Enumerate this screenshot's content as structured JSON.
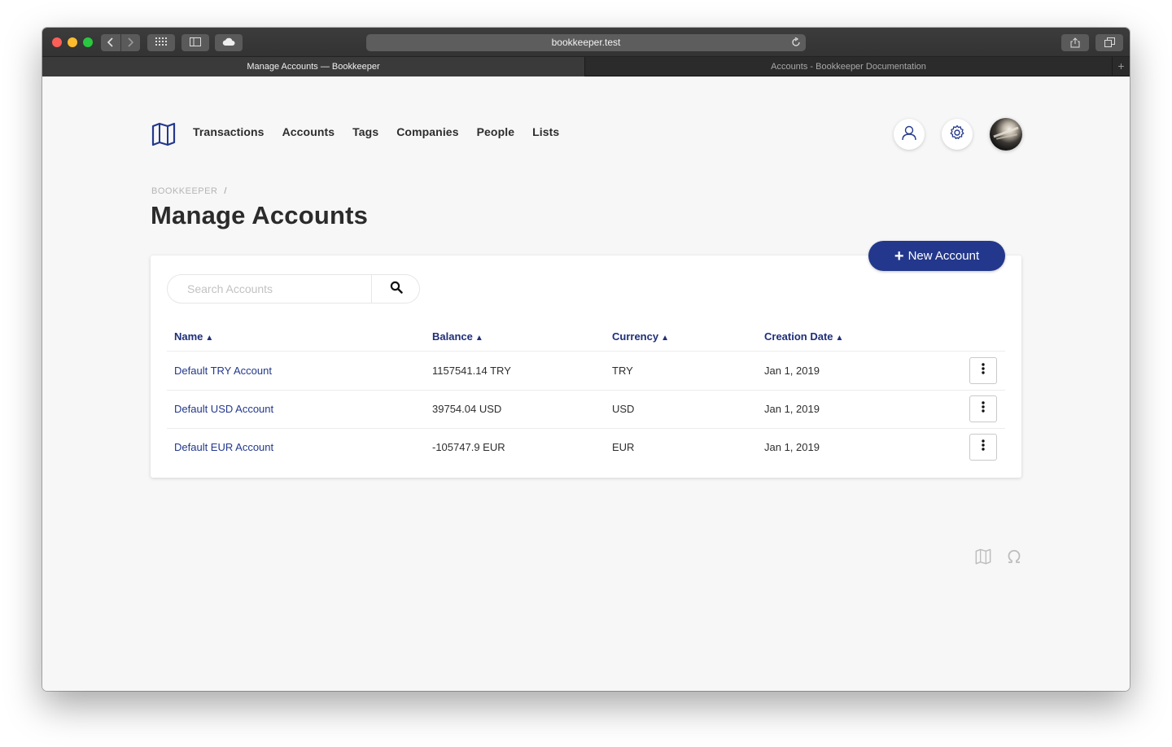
{
  "browser": {
    "url": "bookkeeper.test",
    "tabs": [
      {
        "label": "Manage Accounts — Bookkeeper",
        "active": true
      },
      {
        "label": "Accounts - Bookkeeper Documentation",
        "active": false
      }
    ],
    "new_tab_label": "+"
  },
  "nav": {
    "logo_icon": "map-icon",
    "items": [
      "Transactions",
      "Accounts",
      "Tags",
      "Companies",
      "People",
      "Lists"
    ]
  },
  "breadcrumb": {
    "root": "BOOKKEEPER",
    "separator": "/"
  },
  "page_title": "Manage Accounts",
  "new_account_button": "New Account",
  "search": {
    "placeholder": "Search Accounts",
    "value": ""
  },
  "table": {
    "columns": [
      "Name",
      "Balance",
      "Currency",
      "Creation Date"
    ],
    "rows": [
      {
        "name": "Default TRY Account",
        "balance": "1157541.14 TRY",
        "currency": "TRY",
        "date": "Jan 1, 2019"
      },
      {
        "name": "Default USD Account",
        "balance": "39754.04 USD",
        "currency": "USD",
        "date": "Jan 1, 2019"
      },
      {
        "name": "Default EUR Account",
        "balance": "-105747.9 EUR",
        "currency": "EUR",
        "date": "Jan 1, 2019"
      }
    ]
  },
  "colors": {
    "accent": "#23388c",
    "header_text": "#1f2f78",
    "page_bg": "#f7f7f7"
  }
}
